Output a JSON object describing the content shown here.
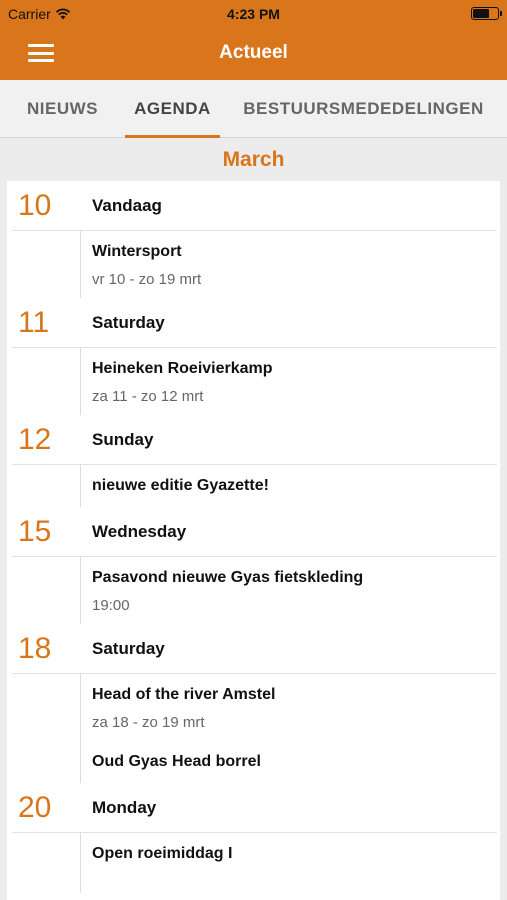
{
  "status": {
    "carrier": "Carrier",
    "time": "4:23 PM",
    "wifi_icon": "wifi-icon",
    "battery_icon": "battery-icon"
  },
  "nav": {
    "title": "Actueel",
    "menu_icon": "hamburger-menu-icon"
  },
  "tabs": [
    {
      "label": "NIEUWS",
      "active": false
    },
    {
      "label": "AGENDA",
      "active": true
    },
    {
      "label": "BESTUURSMEDEDELINGEN",
      "active": false
    }
  ],
  "colors": {
    "accent": "#d9761b",
    "background": "#ececec",
    "card": "#ffffff"
  },
  "month": "March",
  "days": [
    {
      "num": "10",
      "name": "Vandaag",
      "events": [
        {
          "title": "Wintersport",
          "sub": "vr 10 - zo 19 mrt"
        }
      ]
    },
    {
      "num": "11",
      "name": "Saturday",
      "events": [
        {
          "title": "Heineken Roeivierkamp",
          "sub": "za 11 - zo 12 mrt"
        }
      ]
    },
    {
      "num": "12",
      "name": "Sunday",
      "events": [
        {
          "title": "nieuwe editie Gyazette!",
          "sub": ""
        }
      ]
    },
    {
      "num": "15",
      "name": "Wednesday",
      "events": [
        {
          "title": "Pasavond nieuwe Gyas fietskleding",
          "sub": "19:00"
        }
      ]
    },
    {
      "num": "18",
      "name": "Saturday",
      "events": [
        {
          "title": "Head of the river Amstel",
          "sub": "za 18 - zo 19 mrt"
        },
        {
          "title": "Oud Gyas Head borrel",
          "sub": ""
        }
      ]
    },
    {
      "num": "20",
      "name": "Monday",
      "events": [
        {
          "title": "Open roeimiddag I",
          "sub": ""
        }
      ]
    }
  ]
}
